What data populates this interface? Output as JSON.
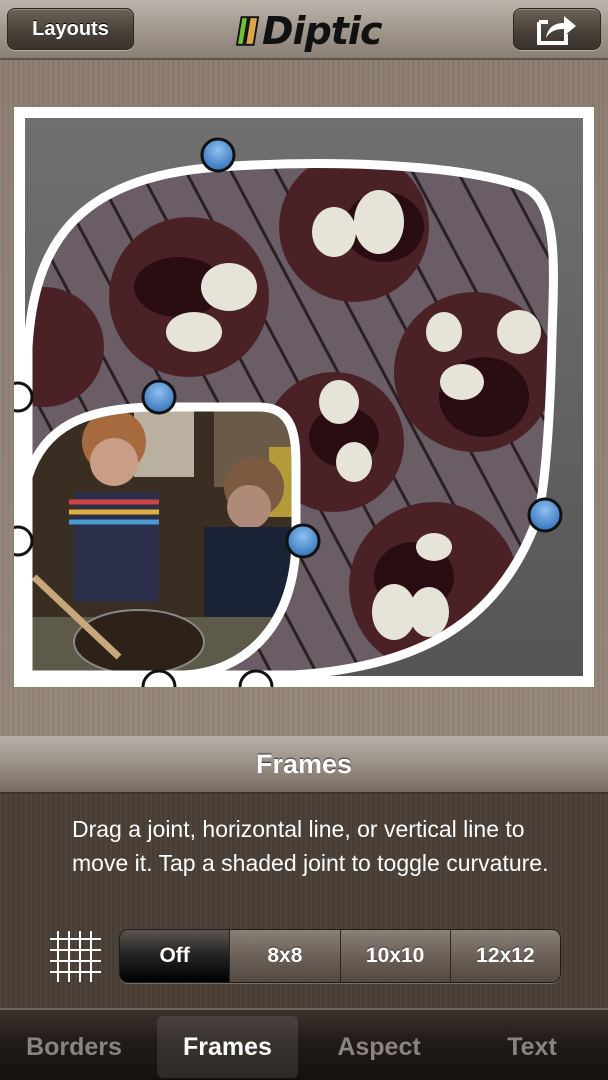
{
  "navbar": {
    "layouts_label": "Layouts",
    "logo_text": "Diptic",
    "logo_colors": [
      "#6fbf3a",
      "#d9a64a"
    ],
    "share_icon": "share-icon"
  },
  "editor": {
    "photos": [
      {
        "name": "cookies-photo",
        "description": "chocolate marshmallow cookies on cooling rack"
      },
      {
        "name": "kids-baking-photo",
        "description": "two boys mixing dough in a bowl"
      }
    ],
    "joint_colors": {
      "shaded": "#4f8fd3",
      "unshaded": "#ffffff"
    },
    "frame_border_color": "#ffffff",
    "background_color": "#6b6b6b"
  },
  "panel": {
    "title": "Frames",
    "help_text": "Drag a joint, horizontal line, or vertical line to move it. Tap a shaded joint to toggle curvature.",
    "grid_icon": "grid-icon",
    "grid_options": [
      {
        "label": "Off",
        "selected": true
      },
      {
        "label": "8x8",
        "selected": false
      },
      {
        "label": "10x10",
        "selected": false
      },
      {
        "label": "12x12",
        "selected": false
      }
    ]
  },
  "tabs": [
    {
      "label": "Borders",
      "active": false
    },
    {
      "label": "Frames",
      "active": true
    },
    {
      "label": "Aspect",
      "active": false
    },
    {
      "label": "Text",
      "active": false
    }
  ]
}
